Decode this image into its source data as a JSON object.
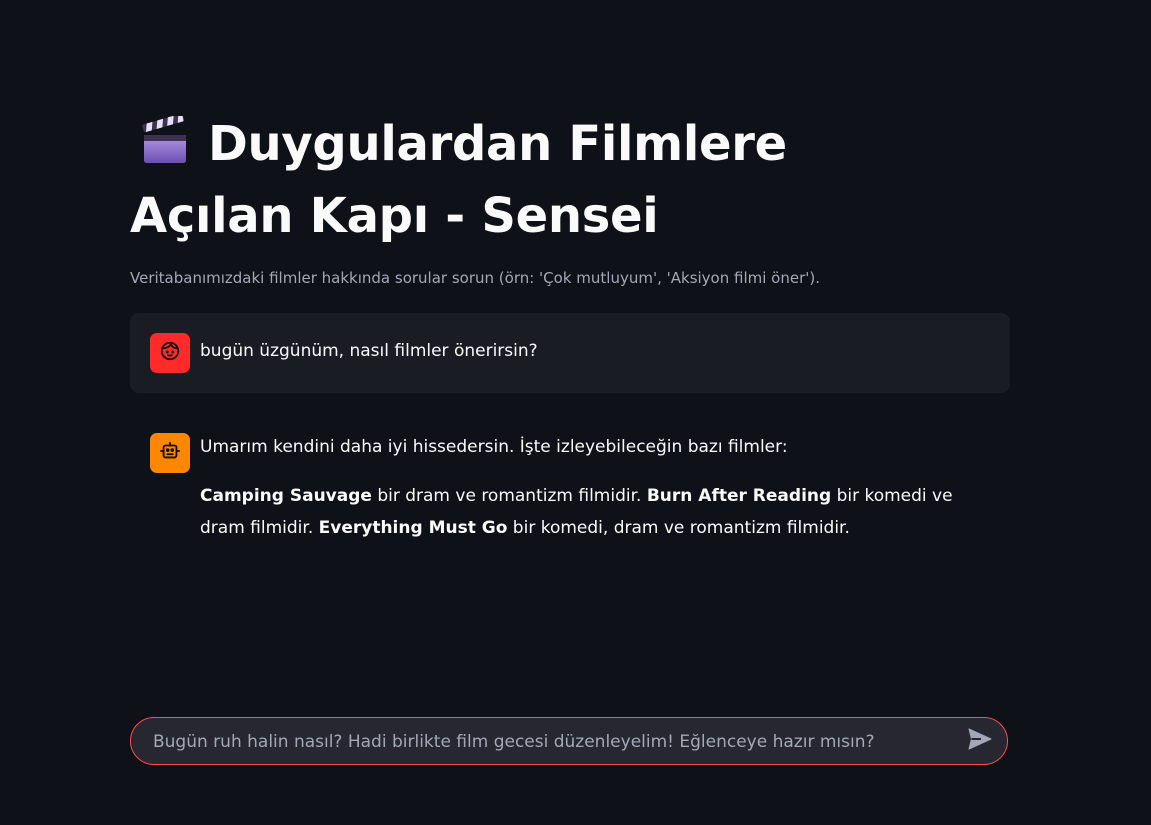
{
  "page": {
    "title": "Duygulardan Filmlere Açılan Kapı - Sensei",
    "title_icon": "clapper-board-icon",
    "caption": "Veritabanımızdaki filmler hakkında sorular sorun (örn: 'Çok mutluyum', 'Aksiyon filmi öner')."
  },
  "messages": [
    {
      "role": "user",
      "avatar_icon": "user-face-icon",
      "avatar_color": "#ff2b2b",
      "text": "bugün üzgünüm, nasıl filmler önerirsin?"
    },
    {
      "role": "assistant",
      "avatar_icon": "robot-icon",
      "avatar_color": "#ff8700",
      "intro": "Umarım kendini daha iyi hissedersin. İşte izleyebileceğin bazı filmler:",
      "films": [
        {
          "title": "Camping Sauvage",
          "desc": " bir dram ve romantizm filmidir. "
        },
        {
          "title": "Burn After Reading",
          "desc": " bir komedi ve dram filmidir. "
        },
        {
          "title": "Everything Must Go",
          "desc": " bir komedi, dram ve romantizm filmidir."
        }
      ]
    }
  ],
  "chat_input": {
    "placeholder": "Bugün ruh halin nasıl? Hadi birlikte film gecesi düzenleyelim! Eğlenceye hazır mısın?",
    "value": "",
    "send_icon": "send-icon",
    "border_color": "#ff4b4b"
  },
  "colors": {
    "background": "#0e1117",
    "user_bubble": "#1a1c24",
    "text": "#fafafa",
    "muted": "#a3a8b8"
  }
}
